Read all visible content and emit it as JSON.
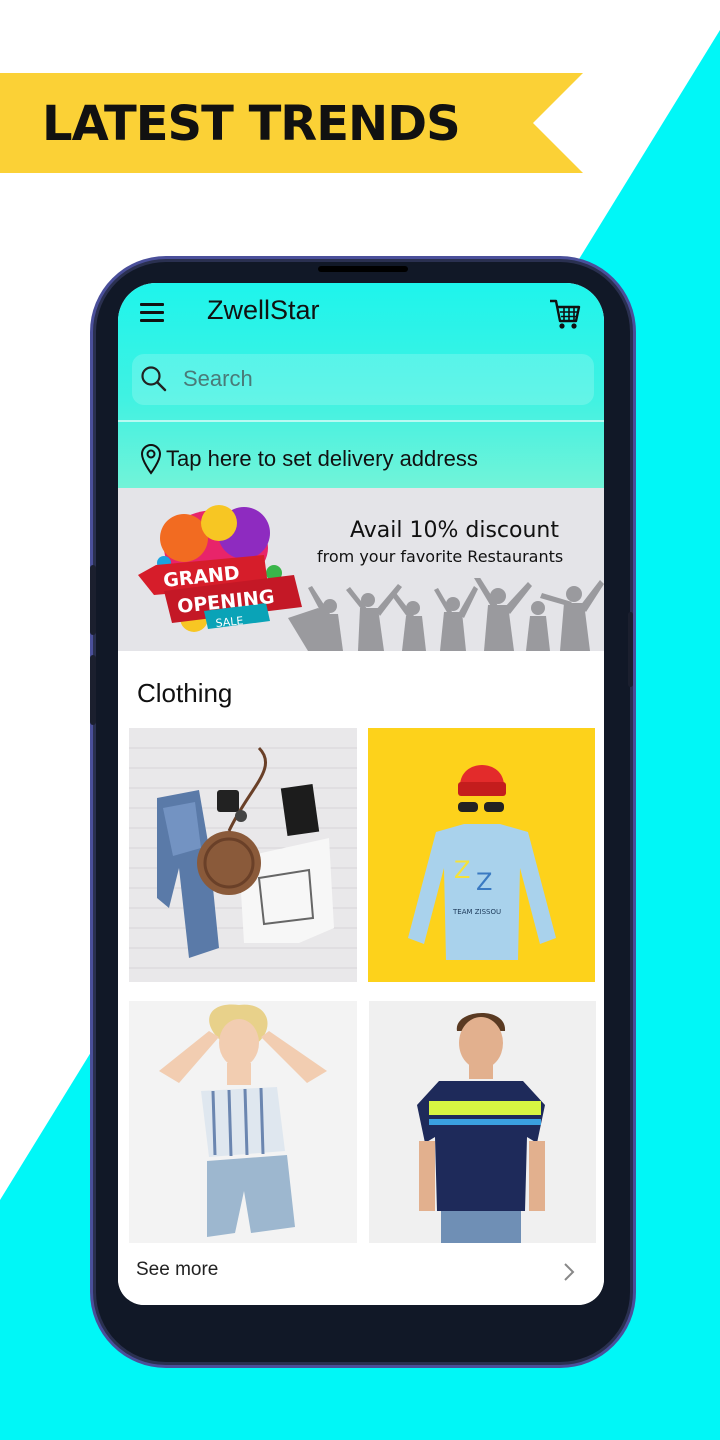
{
  "banner": {
    "title": "LATEST TRENDS"
  },
  "app": {
    "title": "ZwellStar",
    "search_placeholder": "Search",
    "delivery_prompt": "Tap here to set delivery address"
  },
  "promo": {
    "logo_lines": [
      "GRAND",
      "OPENING",
      "SALE"
    ],
    "title": "Avail 10% discount",
    "subtitle": "from your favorite Restaurants"
  },
  "clothing": {
    "heading": "Clothing",
    "see_more": "See more",
    "products": [
      {
        "image": "flat-lay-jeans-bag-tee"
      },
      {
        "image": "blue-sweatshirt-red-beanie",
        "print": "TEAM ZISSOU"
      },
      {
        "image": "woman-striped-top"
      },
      {
        "image": "man-navy-striped-tee"
      }
    ]
  },
  "colors": {
    "accent_cyan": "#1ef4ec",
    "ribbon_yellow": "#fbd136",
    "tile_yellow": "#fdd21b"
  },
  "icons": [
    "hamburger-menu-icon",
    "shopping-cart-icon",
    "search-icon",
    "location-pin-icon",
    "chevron-right-icon"
  ]
}
